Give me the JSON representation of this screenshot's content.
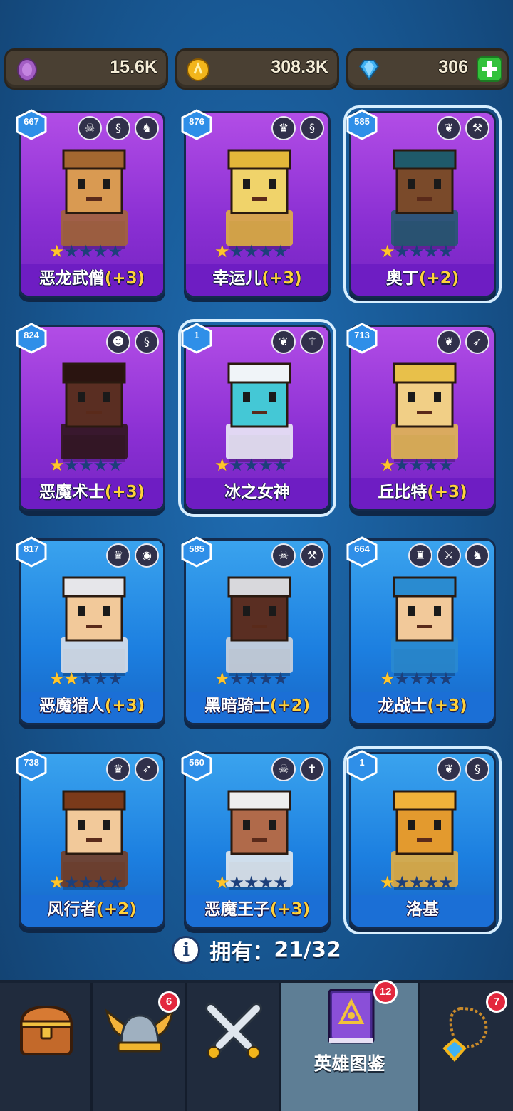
{
  "currency": {
    "purple_coins": "15.6K",
    "gold_coins": "308.3K",
    "gems": "306"
  },
  "heroes": [
    {
      "level": "667",
      "name": "恶龙武僧",
      "bonus": "(+3)",
      "stars": 1,
      "rarity": "purple",
      "classes": [
        "skull-icon",
        "dragon-icon",
        "dragon-head-icon"
      ],
      "selected": false,
      "skin": "#d99a52",
      "hair": "#a46730"
    },
    {
      "level": "876",
      "name": "幸运儿",
      "bonus": "(+3)",
      "stars": 1,
      "rarity": "purple",
      "classes": [
        "elf-icon",
        "dragon-icon"
      ],
      "selected": false,
      "skin": "#f0d36a",
      "hair": "#e4b73a"
    },
    {
      "level": "585",
      "name": "奥丁",
      "bonus": "(+2)",
      "stars": 1,
      "rarity": "purple",
      "classes": [
        "wings-icon",
        "hammer-icon"
      ],
      "selected": true,
      "skin": "#7a4a2a",
      "hair": "#1f5a6a"
    },
    {
      "level": "824",
      "name": "恶魔术士",
      "bonus": "(+3)",
      "stars": 1,
      "rarity": "purple",
      "classes": [
        "mask-icon",
        "dragon-icon"
      ],
      "selected": false,
      "skin": "#5a2e22",
      "hair": "#2a1410"
    },
    {
      "level": "1",
      "name": "冰之女神",
      "bonus": "",
      "stars": 1,
      "rarity": "purple",
      "classes": [
        "wings-icon",
        "staff-icon"
      ],
      "selected": true,
      "skin": "#44c8d6",
      "hair": "#f0f4f8"
    },
    {
      "level": "713",
      "name": "丘比特",
      "bonus": "(+3)",
      "stars": 1,
      "rarity": "purple",
      "classes": [
        "wings-icon",
        "bow-icon"
      ],
      "selected": false,
      "skin": "#f1cf86",
      "hair": "#e8c04a"
    },
    {
      "level": "817",
      "name": "恶魔猎人",
      "bonus": "(+3)",
      "stars": 2,
      "rarity": "blue",
      "classes": [
        "elf-icon",
        "eye-icon"
      ],
      "selected": false,
      "skin": "#f2c99a",
      "hair": "#e6e6ea"
    },
    {
      "level": "585",
      "name": "黑暗骑士",
      "bonus": "(+2)",
      "stars": 1,
      "rarity": "blue",
      "classes": [
        "skull-icon",
        "hammer-icon"
      ],
      "selected": false,
      "skin": "#5a2e22",
      "hair": "#d8d8dc"
    },
    {
      "level": "664",
      "name": "龙战士",
      "bonus": "(+3)",
      "stars": 1,
      "rarity": "blue",
      "classes": [
        "helmet-icon",
        "sword-icon",
        "dragon-head-icon"
      ],
      "selected": false,
      "skin": "#f2c99a",
      "hair": "#2a8bd0"
    },
    {
      "level": "738",
      "name": "风行者",
      "bonus": "(+2)",
      "stars": 1,
      "rarity": "blue",
      "classes": [
        "elf-icon",
        "bow-icon"
      ],
      "selected": false,
      "skin": "#f2c99a",
      "hair": "#7a3a1a"
    },
    {
      "level": "560",
      "name": "恶魔王子",
      "bonus": "(+3)",
      "stars": 1,
      "rarity": "blue",
      "classes": [
        "skull-icon",
        "dagger-icon"
      ],
      "selected": false,
      "skin": "#b06a4a",
      "hair": "#eeeeee"
    },
    {
      "level": "1",
      "name": "洛基",
      "bonus": "",
      "stars": 1,
      "rarity": "blue",
      "classes": [
        "wings-icon",
        "dragon-icon"
      ],
      "selected": true,
      "skin": "#e39a2e",
      "hair": "#f0b23a"
    }
  ],
  "owned": {
    "label": "拥有：",
    "count": "21/32"
  },
  "nav": {
    "chest_badge": "",
    "helmet_badge": "6",
    "battle_badge": "",
    "heroes_badge": "12",
    "heroes_label": "英雄图鉴",
    "amulet_badge": "7"
  },
  "colors": {
    "purple_card": "#8a2fd3",
    "blue_card": "#1c7fe0",
    "star_on": "#ffc52b",
    "bonus_text": "#ffd23a"
  }
}
